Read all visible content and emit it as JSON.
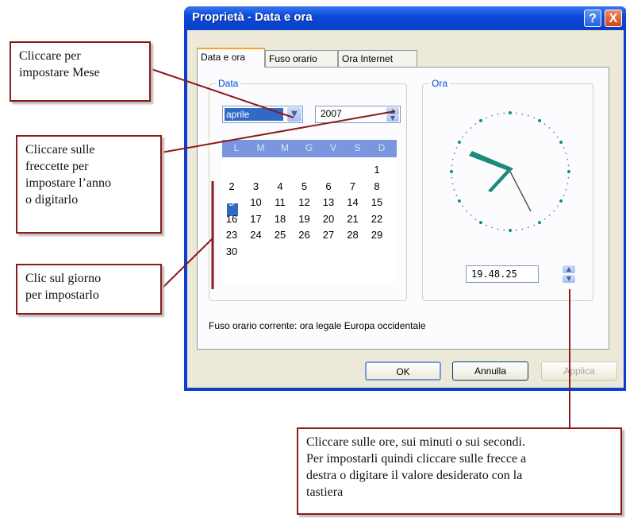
{
  "window": {
    "title": "Proprietà - Data e ora",
    "help_label": "?",
    "close_label": "X"
  },
  "tabs": [
    {
      "label": "Data e ora"
    },
    {
      "label": "Fuso orario"
    },
    {
      "label": "Ora Internet"
    }
  ],
  "date_group": {
    "label": "Data",
    "month": "aprile",
    "year": "2007",
    "day_names": [
      "L",
      "M",
      "M",
      "G",
      "V",
      "S",
      "D"
    ],
    "weeks": [
      [
        "",
        "",
        "",
        "",
        "",
        "",
        "1"
      ],
      [
        "2",
        "3",
        "4",
        "5",
        "6",
        "7",
        "8"
      ],
      [
        "9",
        "10",
        "11",
        "12",
        "13",
        "14",
        "15"
      ],
      [
        "16",
        "17",
        "18",
        "19",
        "20",
        "21",
        "22"
      ],
      [
        "23",
        "24",
        "25",
        "26",
        "27",
        "28",
        "29"
      ],
      [
        "30",
        "",
        "",
        "",
        "",
        "",
        ""
      ]
    ],
    "selected_day": "9"
  },
  "time_group": {
    "label": "Ora",
    "time": "19.48.25"
  },
  "timezone_text": "Fuso orario corrente:  ora legale Europa occidentale",
  "buttons": {
    "ok": "OK",
    "cancel": "Annulla",
    "apply": "Applica"
  },
  "callouts": {
    "month": [
      "Cliccare per",
      "impostare Mese"
    ],
    "year": [
      "Cliccare sulle",
      "freccette per",
      "impostare l’anno",
      "o digitarlo"
    ],
    "day": [
      "Clic sul giorno",
      "per impostarlo"
    ],
    "time": [
      "Cliccare sulle ore, sui minuti o sui secondi.",
      "Per impostarli quindi cliccare sulle frecce a",
      "destra o digitare il valore desiderato con la",
      "tastiera"
    ]
  },
  "colors": {
    "callout_border": "#8b1a1a",
    "titlebar": "#0a4ad8",
    "accent_select": "#316ac5",
    "clock_hands": "#1a8a7a"
  }
}
